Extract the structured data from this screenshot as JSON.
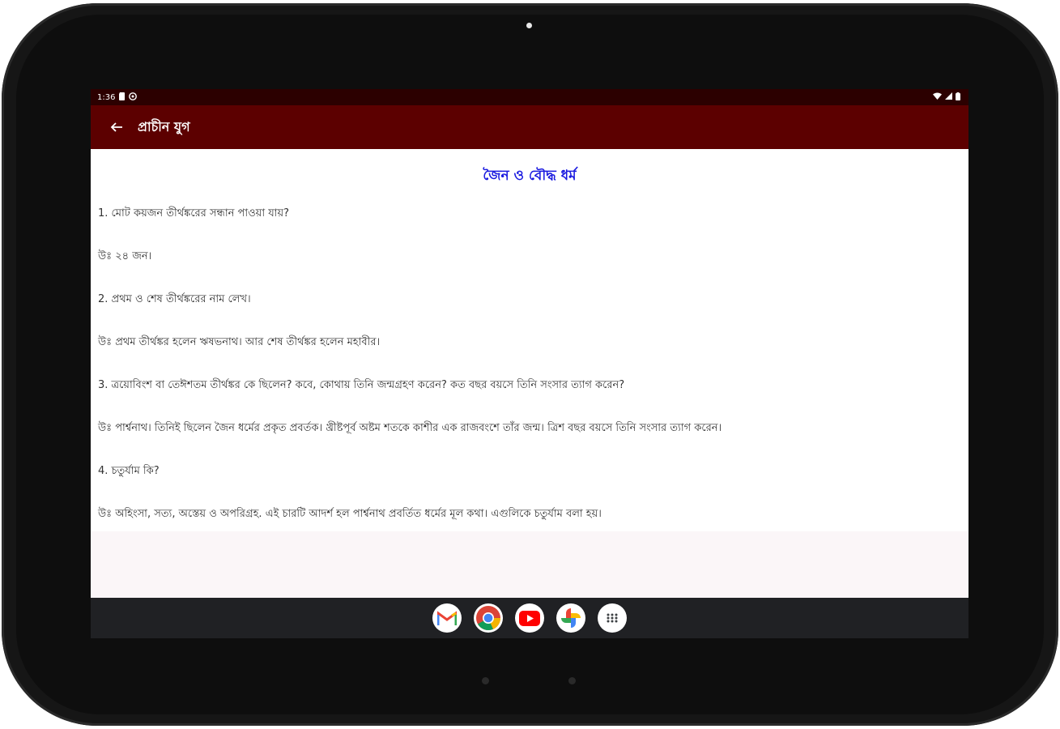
{
  "status_bar": {
    "time": "1:36",
    "left_icons": [
      "sim-card-icon",
      "settings-circle-icon"
    ],
    "right_icons": [
      "wifi-icon",
      "signal-icon",
      "battery-icon"
    ]
  },
  "app_bar": {
    "title": "প্রাচীন যুগ",
    "back_icon": "arrow-back-icon",
    "color": "#5c0000"
  },
  "content": {
    "heading": "জৈন ও বৌদ্ধ ধর্ম",
    "heading_color": "#1a1ae0",
    "lines": [
      "1. মোট কয়জন তীর্থঙ্করের সন্ধান পাওয়া যায়?",
      "উঃ ২৪ জন।",
      "2. প্রথম ও শেষ তীর্থঙ্করের নাম লেখ।",
      "উঃ প্রথম তীর্থঙ্কর হলেন ঋষভনাথ। আর শেষ তীর্থঙ্কর হলেন মহাবীর।",
      "3. ত্রয়োবিংশ বা তেঈশতম তীর্থঙ্কর কে ছিলেন? কবে, কোথায় তিনি জন্মগ্রহণ করেন? কত বছর বয়সে তিনি সংসার ত্যাগ করেন?",
      "উঃ পার্শ্বনাথ। তিনিই ছিলেন জৈন ধর্মের প্রকৃত প্রবর্তক। খ্রীষ্টপূর্ব অষ্টম শতকে কাশীর এক রাজবংশে তাঁর জন্ম। ত্রিশ বছর বয়সে তিনি সংসার ত্যাগ করেন।",
      "4. চতুর্যাম কি?",
      "উঃ অহিংসা, সত্য, অস্তেয় ও অপরিগ্রহ. এই চারটি আদর্শ হল পার্শ্বনাথ প্রবর্তিত ধর্মের মূল কথা। এগুলিকে চতুর্যাম বলা হয়।"
    ]
  },
  "dock": {
    "apps": [
      "gmail-icon",
      "chrome-icon",
      "youtube-icon",
      "photos-icon",
      "app-drawer-icon"
    ]
  }
}
